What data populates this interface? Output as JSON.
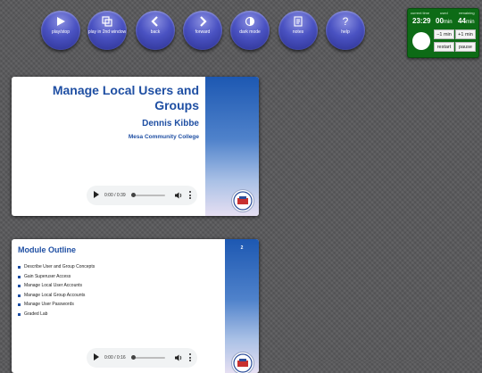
{
  "toolbar": {
    "buttons": [
      {
        "label": "play/stop",
        "icon": "play-icon"
      },
      {
        "label": "play in 2nd window",
        "icon": "window-icon"
      },
      {
        "label": "back",
        "icon": "chevron-left-icon"
      },
      {
        "label": "forward",
        "icon": "chevron-right-icon"
      },
      {
        "label": "dark mode",
        "icon": "half-circle-icon"
      },
      {
        "label": "notes",
        "icon": "notes-icon"
      },
      {
        "label": "help",
        "icon": "question-icon",
        "glyph": "?"
      }
    ]
  },
  "timer": {
    "current_time_label": "current time",
    "current_time": "23:29",
    "used_label": "used",
    "used_value": "00",
    "used_unit": "min",
    "remaining_label": "remaining",
    "remaining_value": "44",
    "remaining_unit": "min",
    "minus_label": "−1 min",
    "plus_label": "+1 min",
    "restart_label": "restart",
    "pause_label": "pause",
    "color": "#0d6b16"
  },
  "slides": [
    {
      "title": "Manage Local Users and Groups",
      "author": "Dennis Kibbe",
      "organization": "Mesa Community College",
      "audio_time": "0:00 / 0:39",
      "audio_progress": 0.0
    },
    {
      "title": "Module Outline",
      "number": "2",
      "items": [
        "Describe User and Group Concepts",
        "Gain Superuser Access",
        "Manage Local User Accounts",
        "Manage Local Group Accounts",
        "Manage User Passwords",
        "Graded Lab"
      ],
      "audio_time": "0:00 / 0:16",
      "audio_progress": 0.0
    }
  ],
  "colors": {
    "accent": "#1f4fa3",
    "button_blue": "#4a52c2"
  }
}
